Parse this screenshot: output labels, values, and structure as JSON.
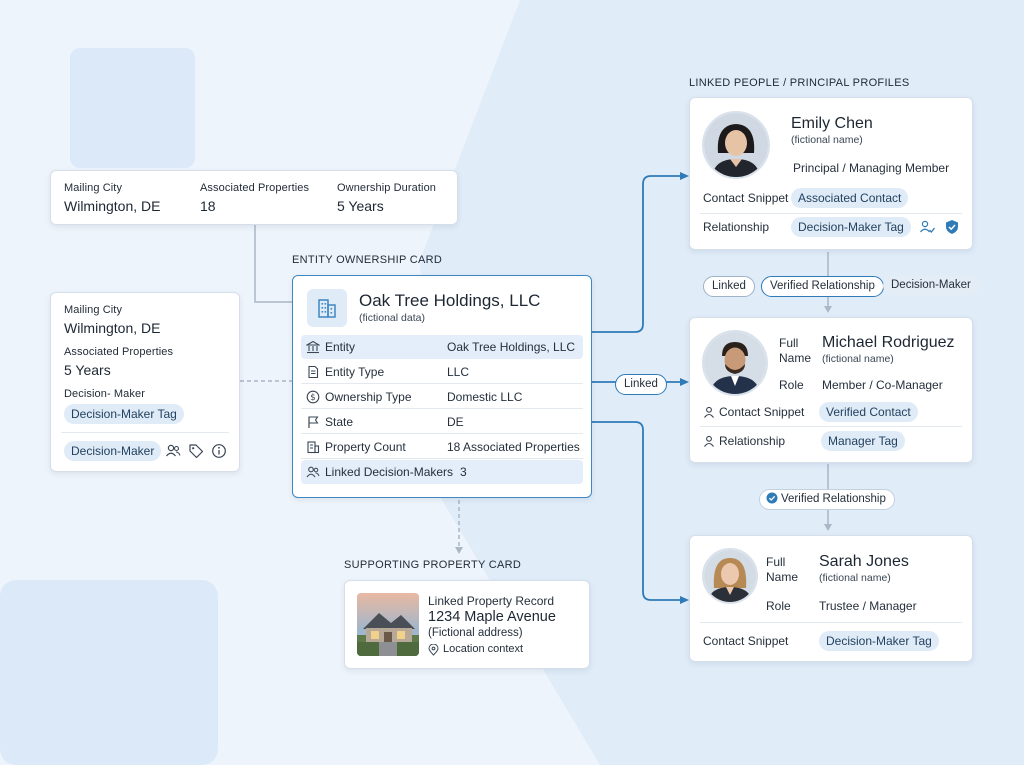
{
  "left_top_card": {
    "col1_label": "Mailing City",
    "col1_value": "Wilmington, DE",
    "col2_label": "Associated Properties",
    "col2_value": "18",
    "col3_label": "Ownership Duration",
    "col3_value": "5 Years"
  },
  "left_side_card": {
    "mailing_city_label": "Mailing City",
    "mailing_city_value": "Wilmington, DE",
    "assoc_label": "Associated Properties",
    "assoc_value": "5 Years",
    "dm_label": "Decision- Maker",
    "dm_tag": "Decision-Maker Tag",
    "footer_tag": "Decision-Maker",
    "icons": [
      "people-icon",
      "tag-icon",
      "info-icon"
    ]
  },
  "entity_card": {
    "section_title": "ENTITY OWNERSHIP CARD",
    "name": "Oak Tree Holdings, LLC",
    "subtitle": "(fictional data)",
    "rows": [
      {
        "icon": "bank-icon",
        "label": "Entity",
        "value": "Oak Tree Holdings, LLC"
      },
      {
        "icon": "doc-icon",
        "label": "Entity Type",
        "value": "LLC"
      },
      {
        "icon": "dollar-icon",
        "label": "Ownership Type",
        "value": "Domestic LLC"
      },
      {
        "icon": "flag-icon",
        "label": "State",
        "value": "DE"
      },
      {
        "icon": "building-icon",
        "label": "Property Count",
        "value": "18 Associated Properties"
      },
      {
        "icon": "people-icon",
        "label": "Linked Decision-Makers",
        "value": "3"
      }
    ]
  },
  "property_card": {
    "section_title": "SUPPORTING PROPERTY CARD",
    "record_label": "Linked Property Record",
    "address": "1234 Maple Avenue",
    "address_note": "(Fictional address)",
    "location": "Location context"
  },
  "people": {
    "section_title": "LINKED PEOPLE / PRINCIPAL PROFILES",
    "emily": {
      "name": "Emily Chen",
      "note": "(fictional name)",
      "role": "Principal / Managing Member",
      "contact_label": "Contact Snippet",
      "contact_tag": "Associated Contact",
      "rel_label": "Relationship",
      "rel_tag": "Decision-Maker Tag"
    },
    "michael": {
      "full_name_label_1": "Full",
      "full_name_label_2": "Name",
      "name": "Michael Rodriguez",
      "note": "(fictional name)",
      "role_label": "Role",
      "role": "Member / Co-Manager",
      "contact_label": "Contact Snippet",
      "contact_tag": "Verified Contact",
      "rel_label": "Relationship",
      "rel_tag": "Manager Tag"
    },
    "sarah": {
      "full_name_label_1": "Full",
      "full_name_label_2": "Name",
      "name": "Sarah Jones",
      "note": "(fictional name)",
      "role_label": "Role",
      "role": "Trustee / Manager",
      "contact_label": "Contact Snippet",
      "contact_tag": "Decision-Maker Tag"
    }
  },
  "connectors": {
    "linked_1": "Linked",
    "verified_1": "Verified Relationship",
    "dm_pill": "Decision-Maker",
    "linked_2": "Linked",
    "verified_2": "Verified Relationship"
  },
  "colors": {
    "accent": "#2e7bb8",
    "tag_bg": "#dfecf8",
    "page_bg": "#eef4fb"
  }
}
